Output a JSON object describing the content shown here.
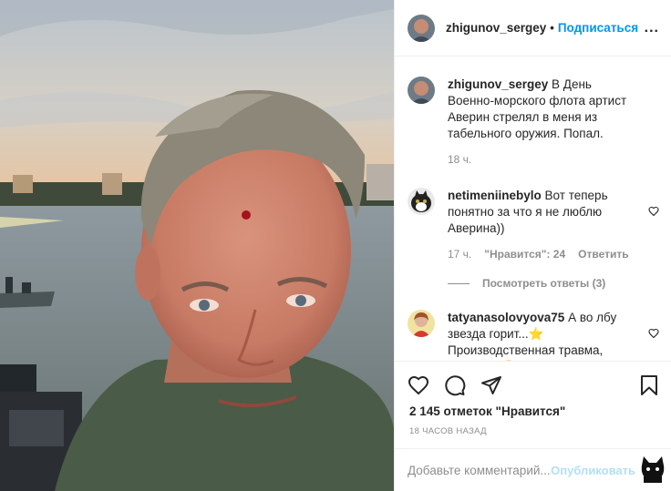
{
  "post": {
    "username": "zhigunov_sergey",
    "dot": "•",
    "follow_label": "Подписаться",
    "more_label": "...",
    "caption": {
      "username": "zhigunov_sergey",
      "text": "В День Военно-морского флота артист Аверин стрелял в меня из табельного оружия. Попал.",
      "time": "18 ч."
    },
    "comments": [
      {
        "username": "netimeniinebylo",
        "text": "Вот теперь понятно за что я не люблю Аверина))",
        "time": "17 ч.",
        "likes": "\"Нравится\": 24",
        "reply_label": "Ответить"
      },
      {
        "username": "tatyanasolovyova75",
        "text": "А во лбу звезда горит...⭐ Производственная травма, однако... 😀 Берегите себя,"
      }
    ],
    "view_replies": "Посмотреть ответы (3)",
    "likes_count": "2 145 отметок \"Нравится\"",
    "timestamp": "18 ЧАСОВ НАЗАД",
    "comment_placeholder": "Добавьте комментарий...",
    "post_button": "Опубликовать"
  },
  "icons": {
    "header_avatar": "profile-avatar",
    "like": "heart-icon",
    "comment": "comment-icon",
    "share": "paper-plane-icon",
    "save": "bookmark-icon",
    "watermark": "cat-watermark"
  },
  "colors": {
    "accent": "#0095f6",
    "text": "#262626",
    "muted": "#8e8e8e",
    "border": "#efefef",
    "post_disabled": "#b2dffc"
  }
}
